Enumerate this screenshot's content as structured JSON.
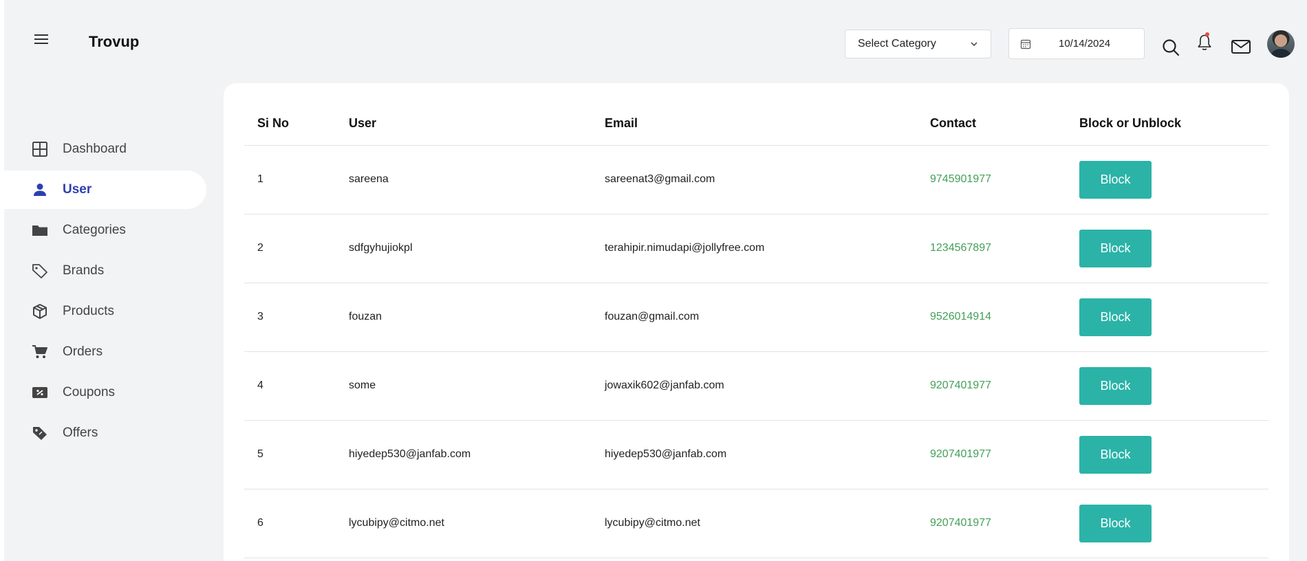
{
  "header": {
    "brand": "Trovup",
    "category_select": {
      "label": "Select Category"
    },
    "date": "10/14/2024"
  },
  "sidebar": {
    "items": [
      {
        "label": "Dashboard",
        "icon": "grid-icon"
      },
      {
        "label": "User",
        "icon": "user-icon",
        "active": true
      },
      {
        "label": "Categories",
        "icon": "folder-icon"
      },
      {
        "label": "Brands",
        "icon": "tag-icon"
      },
      {
        "label": "Products",
        "icon": "box-icon"
      },
      {
        "label": "Orders",
        "icon": "cart-icon"
      },
      {
        "label": "Coupons",
        "icon": "coupon-icon"
      },
      {
        "label": "Offers",
        "icon": "offer-tag-icon"
      }
    ]
  },
  "table": {
    "headers": [
      "Si No",
      "User",
      "Email",
      "Contact",
      "Block or Unblock"
    ],
    "rows": [
      {
        "si": "1",
        "user": "sareena",
        "email": "sareenat3@gmail.com",
        "contact": "9745901977",
        "action": "Block"
      },
      {
        "si": "2",
        "user": "sdfgyhujiokpl",
        "email": "terahipir.nimudapi@jollyfree.com",
        "contact": "1234567897",
        "action": "Block"
      },
      {
        "si": "3",
        "user": "fouzan",
        "email": "fouzan@gmail.com",
        "contact": "9526014914",
        "action": "Block"
      },
      {
        "si": "4",
        "user": "some",
        "email": "jowaxik602@janfab.com",
        "contact": "9207401977",
        "action": "Block"
      },
      {
        "si": "5",
        "user": "hiyedep530@janfab.com",
        "email": "hiyedep530@janfab.com",
        "contact": "9207401977",
        "action": "Block"
      },
      {
        "si": "6",
        "user": "lycubipy@citmo.net",
        "email": "lycubipy@citmo.net",
        "contact": "9207401977",
        "action": "Block"
      }
    ]
  },
  "colors": {
    "accent": "#2bb3a8",
    "active_nav": "#2d3fb0",
    "contact_text": "#43a058",
    "notification_dot": "#e74c3c"
  }
}
